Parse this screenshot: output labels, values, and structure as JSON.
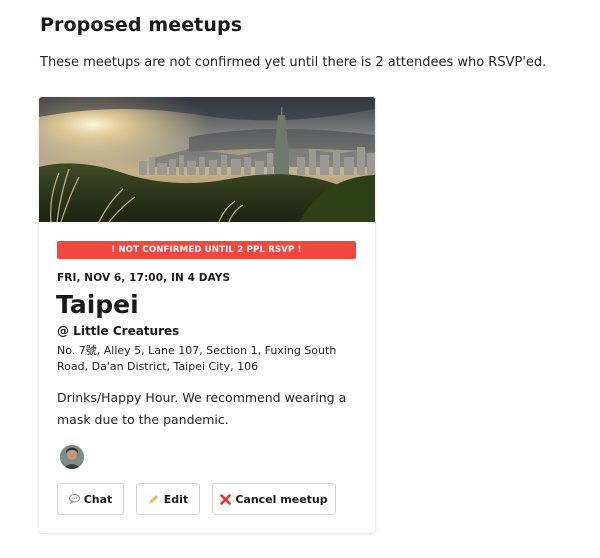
{
  "page": {
    "title": "Proposed meetups",
    "subtitle": "These meetups are not confirmed yet until there is 2 attendees who RSVP'ed."
  },
  "meetup": {
    "warning": "! NOT CONFIRMED UNTIL 2 PPL RSVP !",
    "datetime": "FRI, NOV 6, 17:00, IN 4 DAYS",
    "city": "Taipei",
    "venue": "@ Little Creatures",
    "address": "No. 7號, Alley 5, Lane 107, Section 1, Fuxing South Road, Da'an District, Taipei City, 106",
    "description": "Drinks/Happy Hour. We recommend wearing a mask due to the pandemic.",
    "hero_image": "Taipei skyline at sunset",
    "attendees": [
      "attendee-avatar"
    ]
  },
  "actions": {
    "chat_label": "Chat",
    "chat_icon": "speech-bubble-icon",
    "edit_label": "Edit",
    "edit_icon": "pencil-icon",
    "cancel_label": "Cancel meetup",
    "cancel_icon": "red-x-icon"
  },
  "colors": {
    "warning_bg": "#f2473f",
    "cancel_icon": "#e8302a"
  }
}
